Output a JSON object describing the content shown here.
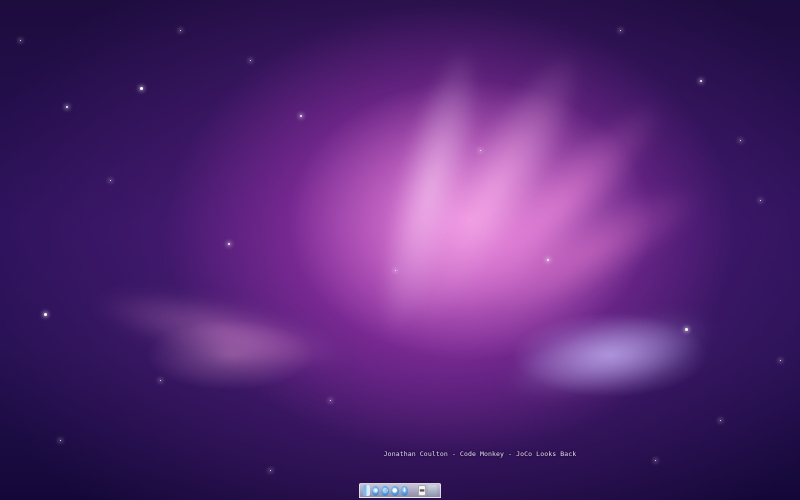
{
  "desktop": {
    "wallpaper": "aurora-galaxy",
    "colors": {
      "deep_space": "#1b0b3a",
      "magenta_glow": "#c24bc8",
      "pink_highlight": "#ffb3ee"
    }
  },
  "now_playing": {
    "text": "Jonathan Coulton - Code Monkey - JoCo Looks Back"
  },
  "dock": {
    "items": [
      {
        "icon": "finder-icon",
        "glyph": ""
      },
      {
        "icon": "network-globe-icon",
        "glyph": "◉"
      },
      {
        "icon": "safari-compass-icon",
        "glyph": "◎"
      },
      {
        "icon": "media-icon",
        "glyph": "●"
      },
      {
        "icon": "download-icon",
        "glyph": "⬇"
      },
      {
        "icon": "document-icon",
        "glyph": "▬"
      },
      {
        "icon": "folder-icon",
        "glyph": ""
      }
    ]
  }
}
